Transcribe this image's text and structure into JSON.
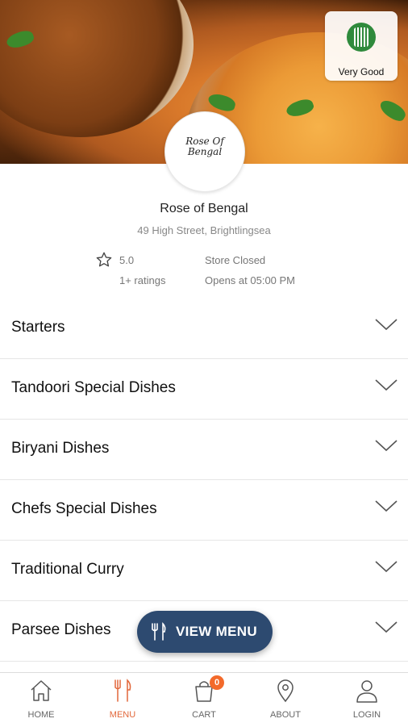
{
  "restaurant": {
    "name": "Rose of Bengal",
    "address": "49 High Street, Brightlingsea",
    "logo_text": "Rose Of Bengal",
    "hygiene_badge": {
      "label": "Very Good",
      "color": "#2f8a3c"
    },
    "rating": "5.0",
    "ratings_count": "1+ ratings",
    "status": "Store Closed",
    "opens_at": "Opens at 05:00 PM"
  },
  "categories": [
    {
      "label": "Starters",
      "icon": "chevron-down-icon"
    },
    {
      "label": "Tandoori Special Dishes",
      "icon": "chevron-down-icon"
    },
    {
      "label": "Biryani Dishes",
      "icon": "chevron-down-icon"
    },
    {
      "label": "Chefs Special Dishes",
      "icon": "chevron-down-icon"
    },
    {
      "label": "Traditional Curry",
      "icon": "chevron-down-icon"
    },
    {
      "label": "Parsee Dishes",
      "icon": "chevron-down-icon"
    }
  ],
  "fab": {
    "label": "VIEW MENU",
    "icon": "cutlery-icon",
    "color": "#2d4a70"
  },
  "nav": {
    "items": [
      {
        "label": "HOME",
        "icon": "home-icon"
      },
      {
        "label": "MENU",
        "icon": "menu-icon",
        "active": true
      },
      {
        "label": "CART",
        "icon": "cart-icon",
        "badge": "0"
      },
      {
        "label": "ABOUT",
        "icon": "location-pin-icon"
      },
      {
        "label": "LOGIN",
        "icon": "user-icon"
      }
    ],
    "active_color": "#e2673a",
    "badge_color": "#f36a2b"
  }
}
